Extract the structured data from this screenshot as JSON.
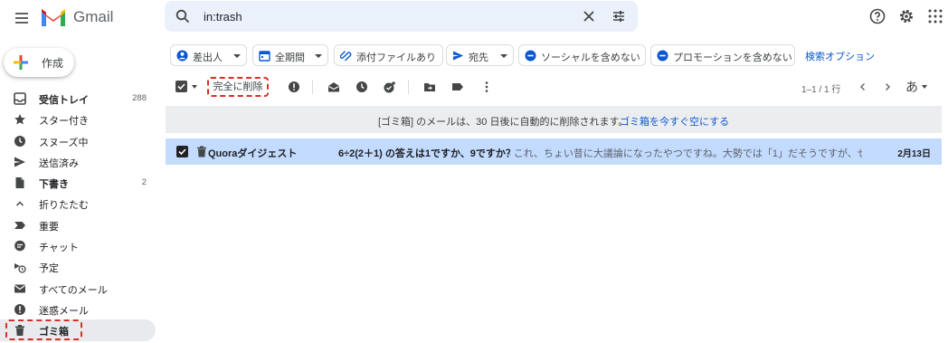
{
  "app": {
    "name": "Gmail"
  },
  "search": {
    "query": "in:trash"
  },
  "compose": {
    "label": "作成"
  },
  "nav": {
    "items": [
      {
        "label": "受信トレイ",
        "count": "288",
        "bold": true,
        "icon": "inbox-icon"
      },
      {
        "label": "スター付き",
        "count": "",
        "bold": false,
        "icon": "star-icon"
      },
      {
        "label": "スヌーズ中",
        "count": "",
        "bold": false,
        "icon": "clock-icon"
      },
      {
        "label": "送信済み",
        "count": "",
        "bold": false,
        "icon": "send-icon"
      },
      {
        "label": "下書き",
        "count": "2",
        "bold": true,
        "icon": "draft-icon"
      },
      {
        "label": "折りたたむ",
        "count": "",
        "bold": false,
        "icon": "chevron-up-icon"
      },
      {
        "label": "重要",
        "count": "",
        "bold": false,
        "icon": "important-icon"
      },
      {
        "label": "チャット",
        "count": "",
        "bold": false,
        "icon": "chat-icon"
      },
      {
        "label": "予定",
        "count": "",
        "bold": false,
        "icon": "scheduled-icon"
      },
      {
        "label": "すべてのメール",
        "count": "",
        "bold": false,
        "icon": "all-mail-icon"
      },
      {
        "label": "迷惑メール",
        "count": "",
        "bold": false,
        "icon": "spam-icon"
      },
      {
        "label": "ゴミ箱",
        "count": "",
        "bold": true,
        "icon": "trash-icon",
        "active": true
      }
    ]
  },
  "chips": [
    {
      "label": "差出人",
      "icon": "person-icon",
      "caret": true
    },
    {
      "label": "全期間",
      "icon": "calendar-icon",
      "caret": true
    },
    {
      "label": "添付ファイルあり",
      "icon": "attachment-icon",
      "caret": false
    },
    {
      "label": "宛先",
      "icon": "send-icon",
      "caret": true
    },
    {
      "label": "ソーシャルを含めない",
      "icon": "minus-circle-icon",
      "caret": false
    },
    {
      "label": "プロモーションを含めない",
      "icon": "minus-circle-icon",
      "caret": false
    }
  ],
  "search_options": "検索オプション",
  "toolbar": {
    "delete_forever": "完全に削除",
    "pagination": "1–1 / 1 行",
    "input_tool": "あ"
  },
  "banner": {
    "text": "[ゴミ箱] のメールは、30 日後に自動的に削除されます。",
    "link": "ゴミ箱を今すぐ空にする"
  },
  "email": {
    "sender": "Quoraダイジェスト",
    "subject": "6÷2(2＋1) の答えは1ですか、9ですか？",
    "snippet": "- これ、ちょい昔に大議論になったやつですね。大勢では「1」だそうですが、せっ...",
    "date": "2月13日"
  },
  "colors": {
    "accent": "#0b57d0",
    "selected_row": "#c2dbff",
    "highlight": "#d93025"
  }
}
